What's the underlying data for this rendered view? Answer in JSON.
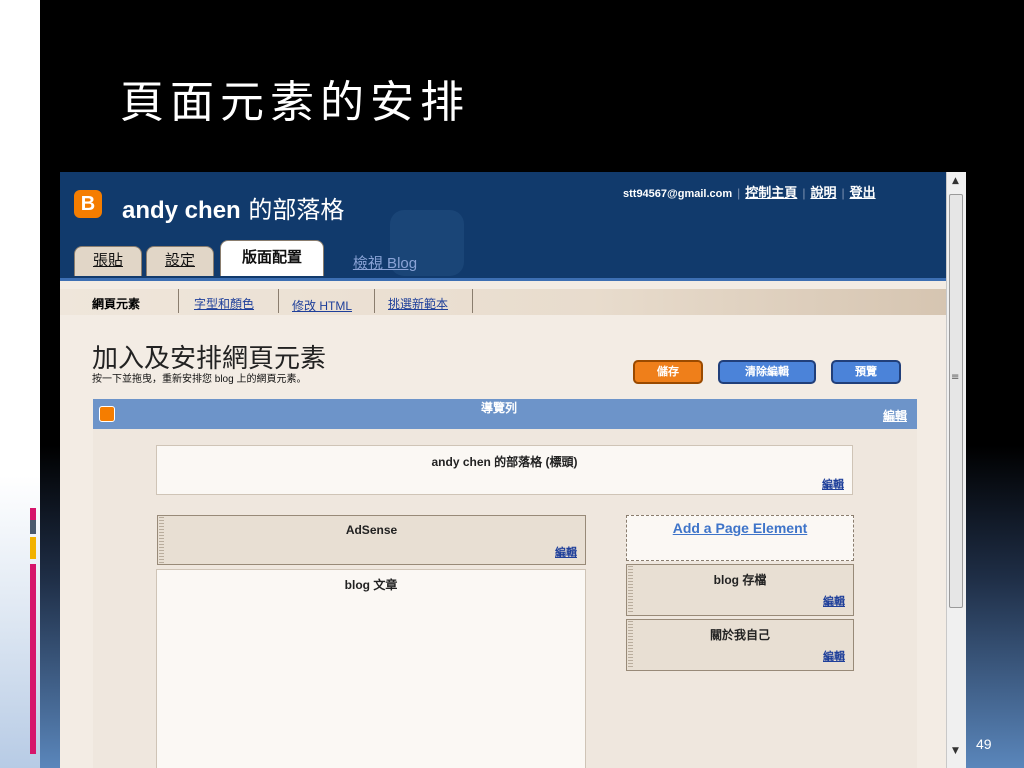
{
  "slide": {
    "title": "頁面元素的安排",
    "page_number": "49"
  },
  "blogger": {
    "logo_glyph": "B",
    "blog_name_prefix": "andy chen",
    "blog_name_suffix": " 的部落格",
    "email": "stt94567@gmail.com",
    "top_links": [
      "控制主頁",
      "說明",
      "登出"
    ],
    "tabs": [
      "張貼",
      "設定",
      "版面配置"
    ],
    "view_blog": "檢視 Blog",
    "subnav": [
      "網頁元素",
      "字型和顏色",
      "修改 HTML",
      "挑選新範本"
    ],
    "page_heading": "加入及安排網頁元素",
    "page_subheading": "按一下並拖曳，重新安排您 blog 上的網頁元素。",
    "buttons": {
      "save": "儲存",
      "clear": "清除編輯",
      "preview": "預覽"
    },
    "navbar": {
      "title": "導覽列",
      "edit": "編輯"
    },
    "header_box": {
      "title": "andy chen 的部落格 (標頭)",
      "edit": "編輯"
    },
    "adsense": {
      "title": "AdSense",
      "edit": "編輯"
    },
    "posts": {
      "title": "blog 文章"
    },
    "add_element": "Add a Page Element",
    "archive": {
      "title": "blog 存檔",
      "edit": "編輯"
    },
    "about": {
      "title": "關於我自己",
      "edit": "編輯"
    }
  },
  "colors": {
    "header_bg": "#113a6c",
    "navbar_bg": "#6d94c9",
    "save_btn": "#ef7f1a",
    "action_btn": "#4b83d9",
    "link": "#1e3f9a"
  }
}
